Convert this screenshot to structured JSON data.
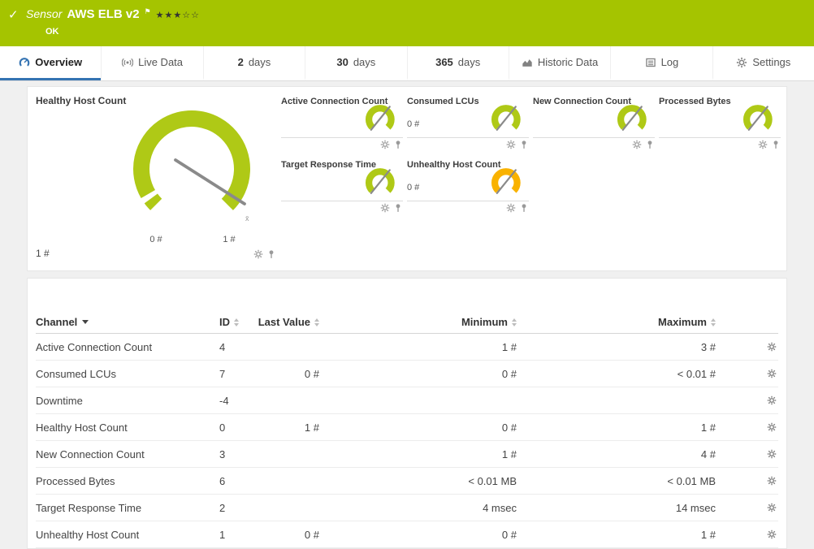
{
  "colors": {
    "header_bg": "#A5C400",
    "gauge_green": "#AFC916",
    "gauge_yellow": "#F9B200",
    "tab_active": "#3473B2",
    "needle": "#8A8A8A"
  },
  "header": {
    "check_icon": "✓",
    "kind": "Sensor",
    "title": "AWS ELB v2",
    "flag_icon": "⚑",
    "stars": "★★★☆☆",
    "status": "OK"
  },
  "tabs": {
    "overview": {
      "label": "Overview"
    },
    "live_data": {
      "label": "Live Data"
    },
    "days_2": {
      "num": "2",
      "unit": "days"
    },
    "days_30": {
      "num": "30",
      "unit": "days"
    },
    "days_365": {
      "num": "365",
      "unit": "days"
    },
    "historic": {
      "label": "Historic Data"
    },
    "log": {
      "label": "Log"
    },
    "settings": {
      "label": "Settings"
    }
  },
  "gauges": {
    "primary": {
      "title": "Healthy Host Count",
      "scale_min": "0 #",
      "scale_max": "1 #",
      "value": "1 #",
      "mean_marker": "x̄"
    },
    "small": [
      {
        "title": "Active Connection Count",
        "value": ""
      },
      {
        "title": "Consumed LCUs",
        "value": "0 #"
      },
      {
        "title": "New Connection Count",
        "value": ""
      },
      {
        "title": "Processed Bytes",
        "value": ""
      },
      {
        "title": "Target Response Time",
        "value": ""
      },
      {
        "title": "Unhealthy Host Count",
        "value": "0 #"
      }
    ]
  },
  "table": {
    "headers": {
      "channel": "Channel",
      "id": "ID",
      "last_value": "Last Value",
      "minimum": "Minimum",
      "maximum": "Maximum"
    },
    "rows": [
      {
        "channel": "Active Connection Count",
        "id": "4",
        "last_value": "",
        "minimum": "1 #",
        "maximum": "3 #"
      },
      {
        "channel": "Consumed LCUs",
        "id": "7",
        "last_value": "0 #",
        "minimum": "0 #",
        "maximum": "< 0.01 #"
      },
      {
        "channel": "Downtime",
        "id": "-4",
        "last_value": "",
        "minimum": "",
        "maximum": ""
      },
      {
        "channel": "Healthy Host Count",
        "id": "0",
        "last_value": "1 #",
        "minimum": "0 #",
        "maximum": "1 #"
      },
      {
        "channel": "New Connection Count",
        "id": "3",
        "last_value": "",
        "minimum": "1 #",
        "maximum": "4 #"
      },
      {
        "channel": "Processed Bytes",
        "id": "6",
        "last_value": "",
        "minimum": "< 0.01 MB",
        "maximum": "< 0.01 MB"
      },
      {
        "channel": "Target Response Time",
        "id": "2",
        "last_value": "",
        "minimum": "4 msec",
        "maximum": "14 msec"
      },
      {
        "channel": "Unhealthy Host Count",
        "id": "1",
        "last_value": "0 #",
        "minimum": "0 #",
        "maximum": "1 #"
      }
    ]
  }
}
